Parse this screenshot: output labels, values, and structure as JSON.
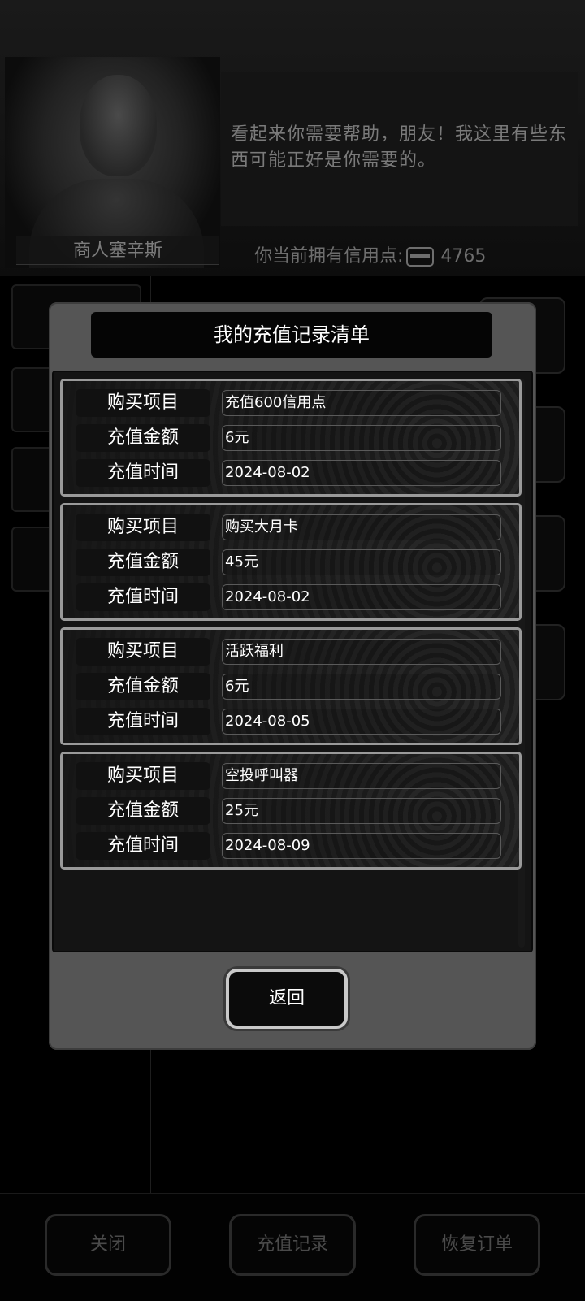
{
  "background": {
    "merchant_name": "商人塞辛斯",
    "dialogue": "看起来你需要帮助，朋友！我这里有些东西可能正好是你需要的。",
    "credits_label": "你当前拥有信用点:",
    "credits_value": "4765",
    "bottom_buttons": {
      "close": "关闭",
      "recharge_record": "充值记录",
      "restore_order": "恢复订单"
    }
  },
  "modal": {
    "title": "我的充值记录清单",
    "labels": {
      "item": "购买项目",
      "amount": "充值金额",
      "time": "充值时间"
    },
    "records": [
      {
        "item": "充值600信用点",
        "amount": "6元",
        "time": "2024-08-02"
      },
      {
        "item": "购买大月卡",
        "amount": "45元",
        "time": "2024-08-02"
      },
      {
        "item": "活跃福利",
        "amount": "6元",
        "time": "2024-08-05"
      },
      {
        "item": "空投呼叫器",
        "amount": "25元",
        "time": "2024-08-09"
      }
    ],
    "return_label": "返回"
  },
  "icons": {
    "credit": "credit-card-icon"
  }
}
